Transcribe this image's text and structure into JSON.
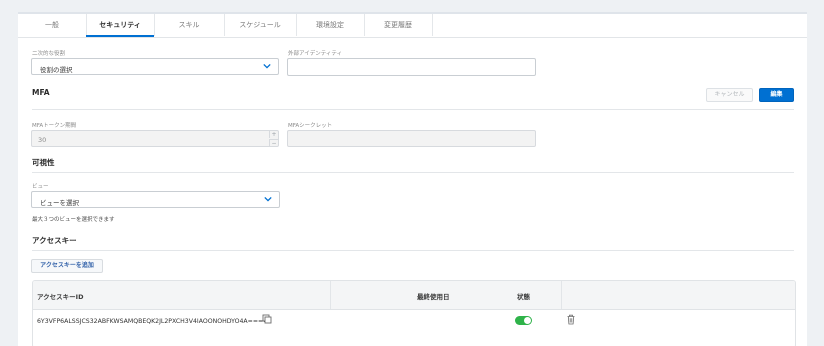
{
  "tabs": [
    {
      "label": "一般",
      "active": false
    },
    {
      "label": "セキュリティ",
      "active": true
    },
    {
      "label": "スキル",
      "active": false
    },
    {
      "label": "スケジュール",
      "active": false
    },
    {
      "label": "環境設定",
      "active": false
    },
    {
      "label": "変更履歴",
      "active": false
    }
  ],
  "security": {
    "secondary_role": {
      "label": "二次的な役割",
      "value": "役割の選択"
    },
    "external_identity": {
      "label": "外部アイデンティティ",
      "value": ""
    }
  },
  "mfa": {
    "heading": "MFA",
    "cancel_label": "キャンセル",
    "edit_label": "編集",
    "token_period": {
      "label": "MFAトークン期間",
      "value": "30"
    },
    "secret": {
      "label": "MFAシークレット",
      "value": ""
    }
  },
  "visibility": {
    "heading": "可視性",
    "view_label": "ビュー",
    "view_value": "ビューを選択",
    "hint": "最大３つのビューを選択できます"
  },
  "access_keys": {
    "heading": "アクセスキー",
    "add_label": "アクセスキーを追加",
    "columns": [
      "アクセスキーID",
      "最終使用日",
      "状態"
    ],
    "rows": [
      {
        "id": "6Y3VFP6ALSSJCS32ABFKWSAMQBEQK2JL2PXCH3V4IAOONOHDYO4A====",
        "last_used": "",
        "enabled": true
      }
    ]
  },
  "colors": {
    "accent": "#0070d2",
    "toggle_on": "#2fb34a"
  }
}
